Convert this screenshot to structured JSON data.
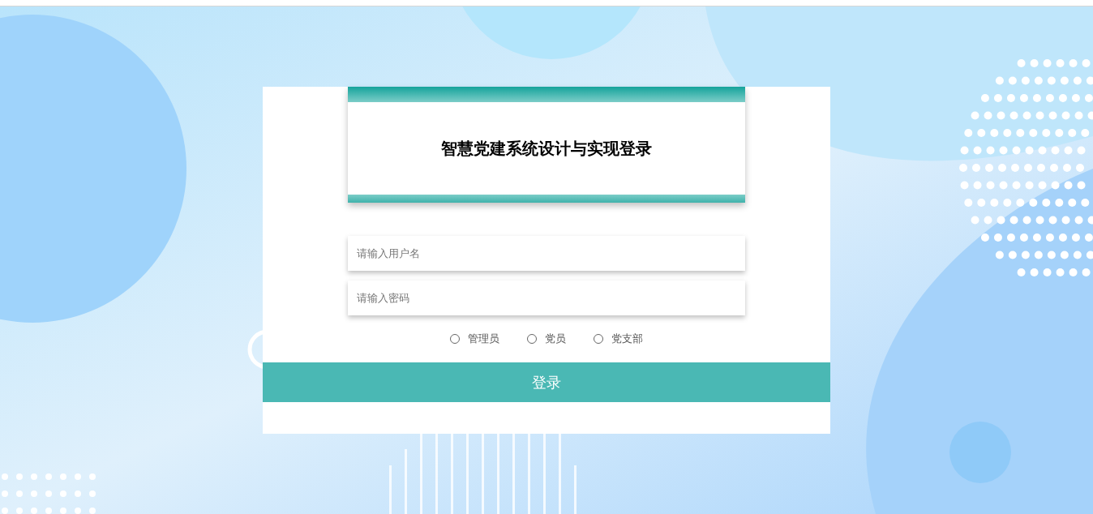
{
  "login": {
    "title": "智慧党建系统设计与实现登录",
    "username": {
      "placeholder": "请输入用户名"
    },
    "password": {
      "placeholder": "请输入密码"
    },
    "roles": [
      {
        "label": "管理员",
        "selected": false
      },
      {
        "label": "党员",
        "selected": false
      },
      {
        "label": "党支部",
        "selected": false
      }
    ],
    "submit": "登录"
  }
}
